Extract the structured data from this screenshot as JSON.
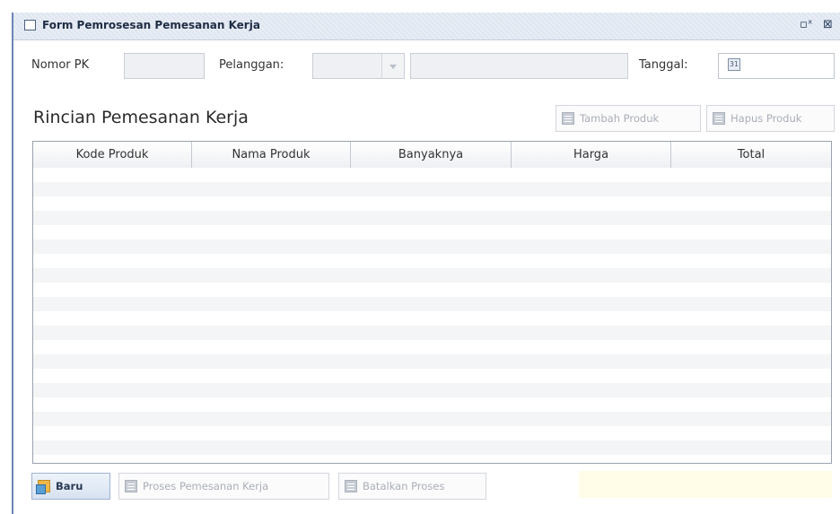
{
  "window": {
    "title": "Form Pemrosesan Pemesanan Kerja",
    "icons": [
      "window-icon",
      "restore-icon",
      "close-icon"
    ]
  },
  "header_form": {
    "nomor_pk_label": "Nomor PK",
    "nomor_pk_value": "",
    "pelanggan_label": "Pelanggan:",
    "pelanggan_selected": "",
    "pelanggan_name_value": "",
    "tanggal_label": "Tanggal:",
    "tanggal_value": ""
  },
  "section": {
    "title": "Rincian Pemesanan Kerja",
    "tambah_produk": "Tambah Produk",
    "hapus_produk": "Hapus Produk"
  },
  "table": {
    "columns": [
      "Kode Produk",
      "Nama Produk",
      "Banyaknya",
      "Harga",
      "Total"
    ],
    "rows": []
  },
  "footer": {
    "baru": "Baru",
    "proses": "Proses Pemesanan Kerja",
    "batalkan": "Batalkan Proses",
    "status_text": ""
  },
  "colors": {
    "frame_accent": "#6a86b4",
    "status_bg": "#fffde8"
  }
}
